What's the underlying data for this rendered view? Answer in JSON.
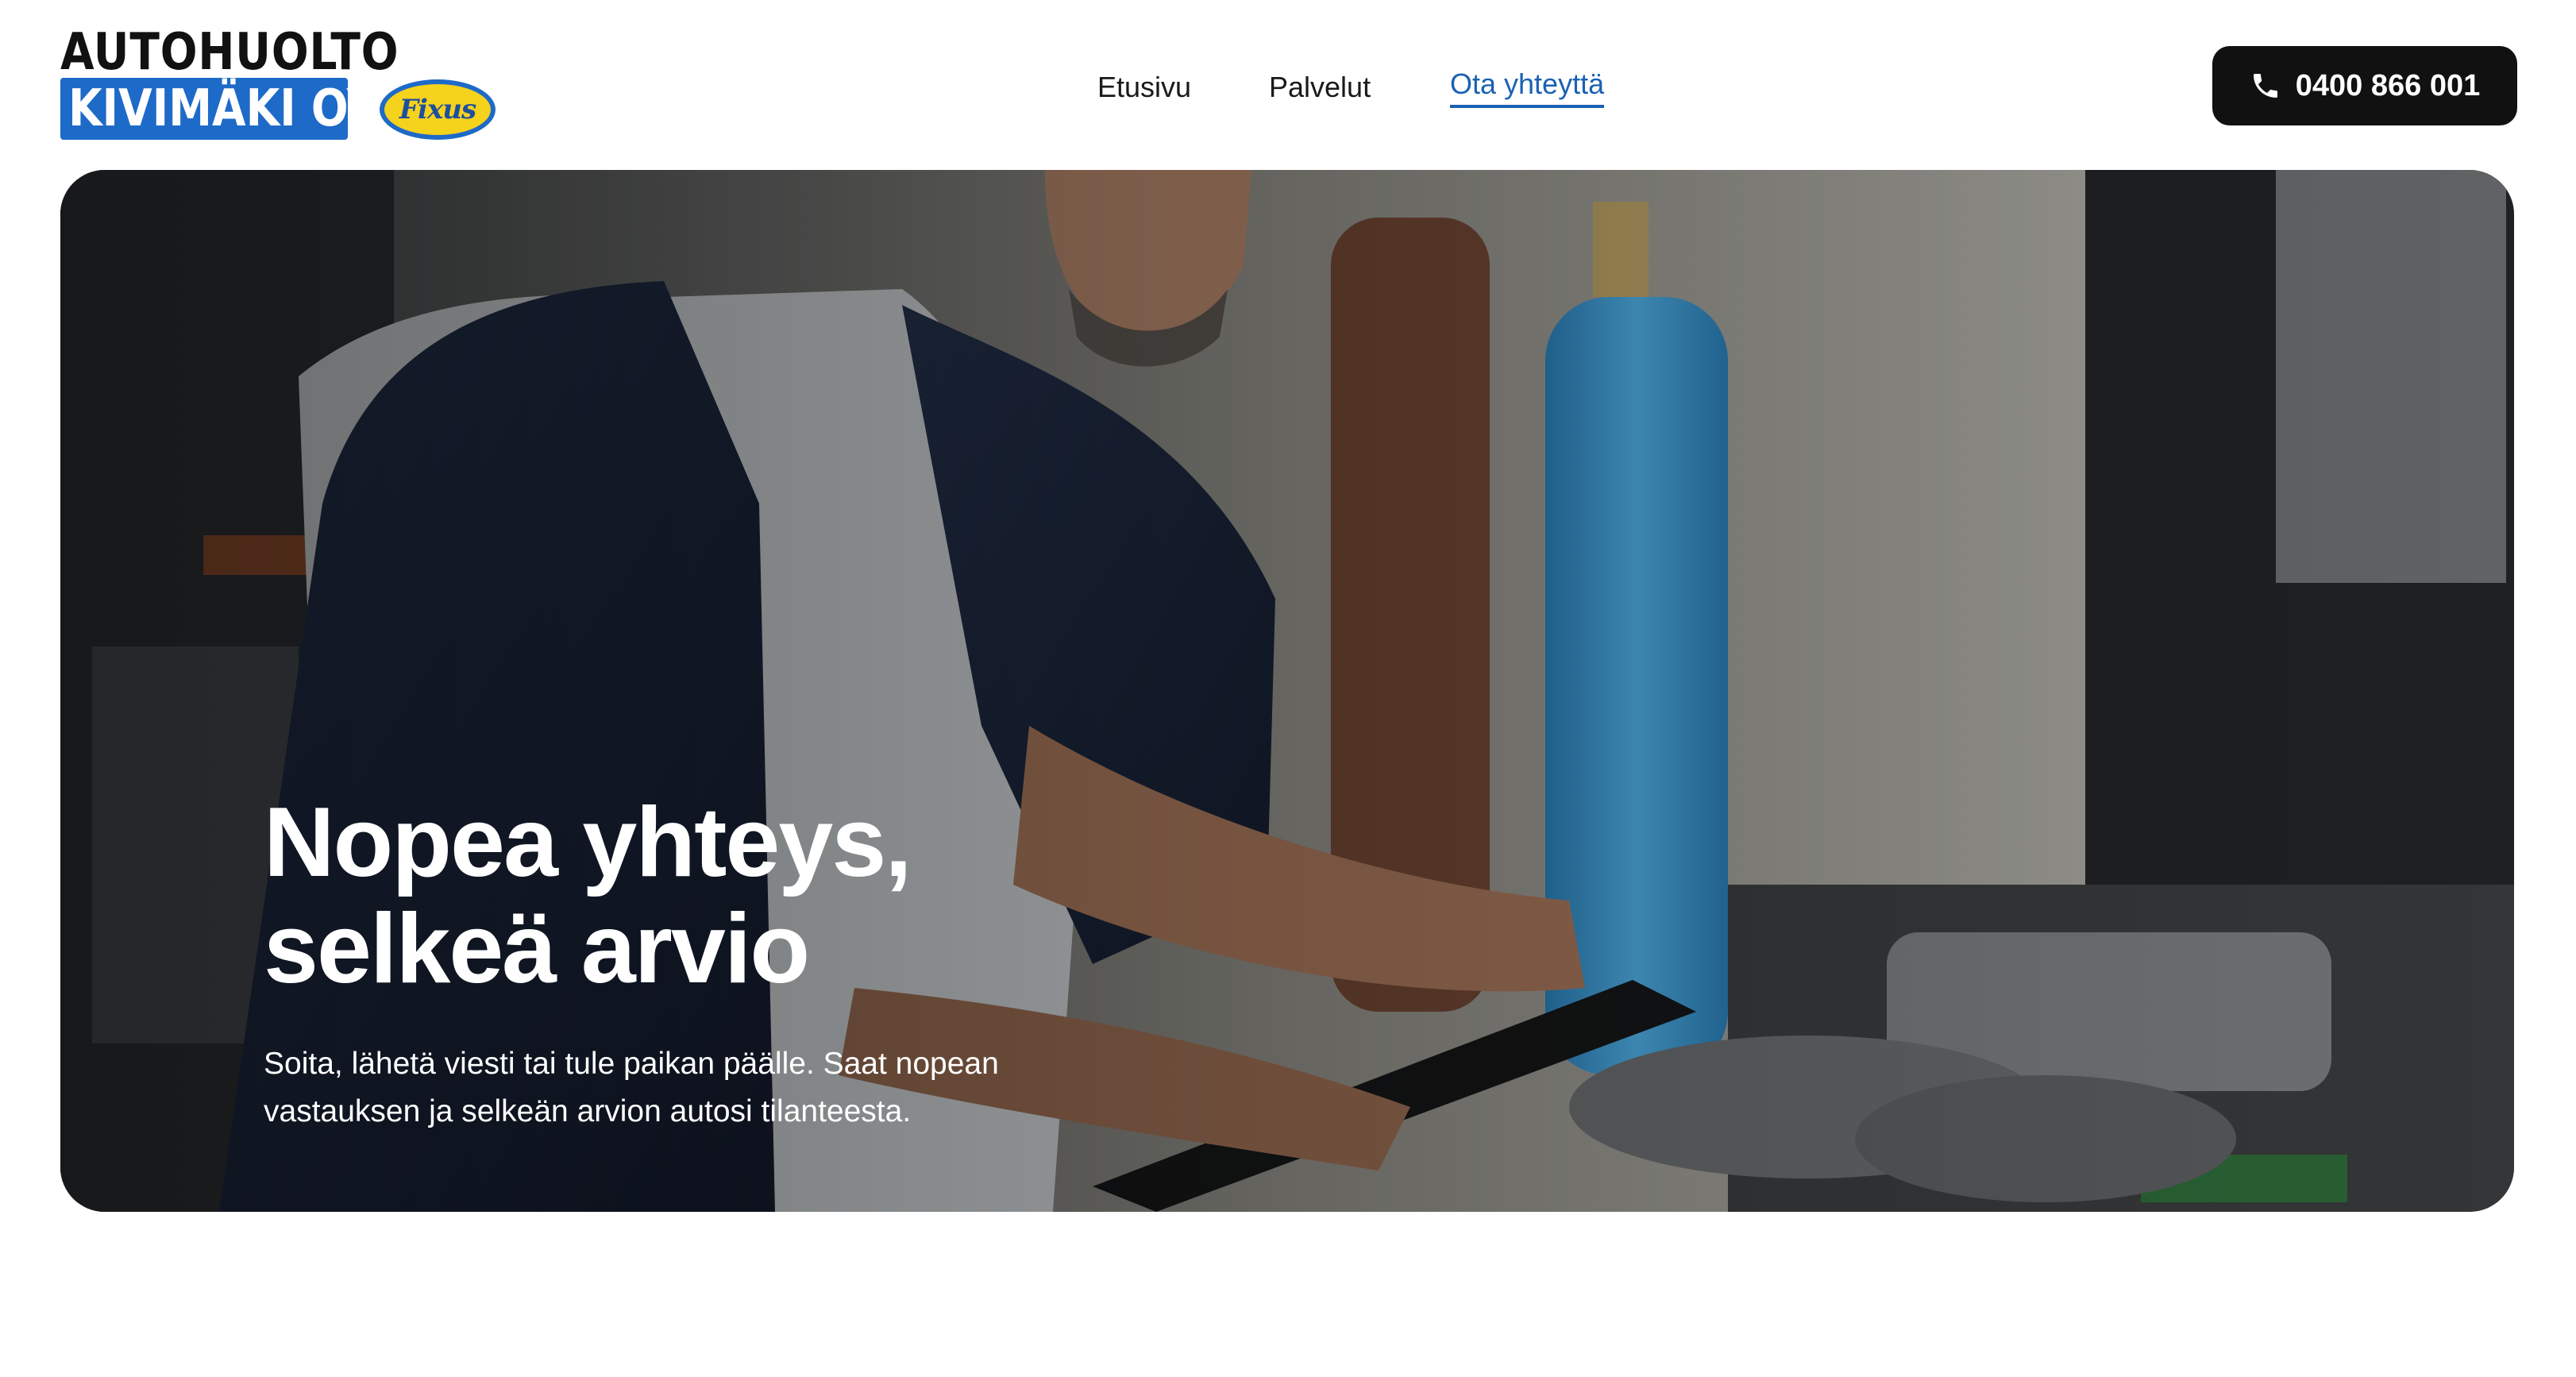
{
  "brand": {
    "line1": "AUTOHUOLTO",
    "line2": "KIVIMÄKI OY",
    "partner_badge": "Fixus",
    "colors": {
      "brand_blue": "#1e6ac8",
      "badge_yellow": "#f5d21c"
    }
  },
  "nav": {
    "items": [
      {
        "label": "Etusivu",
        "active": false
      },
      {
        "label": "Palvelut",
        "active": false
      },
      {
        "label": "Ota yhteyttä",
        "active": true
      }
    ],
    "active_color": "#1a62b3"
  },
  "cta": {
    "phone": "0400 866 001",
    "icon": "phone-icon",
    "background": "#111111"
  },
  "hero": {
    "title_line1": "Nopea yhteys,",
    "title_line2": "selkeä arvio",
    "text_line1": "Soita, lähetä viesti tai tule paikan päälle. Saat nopean",
    "text_line2": "vastauksen ja selkeän arvion autosi tilanteesta."
  }
}
